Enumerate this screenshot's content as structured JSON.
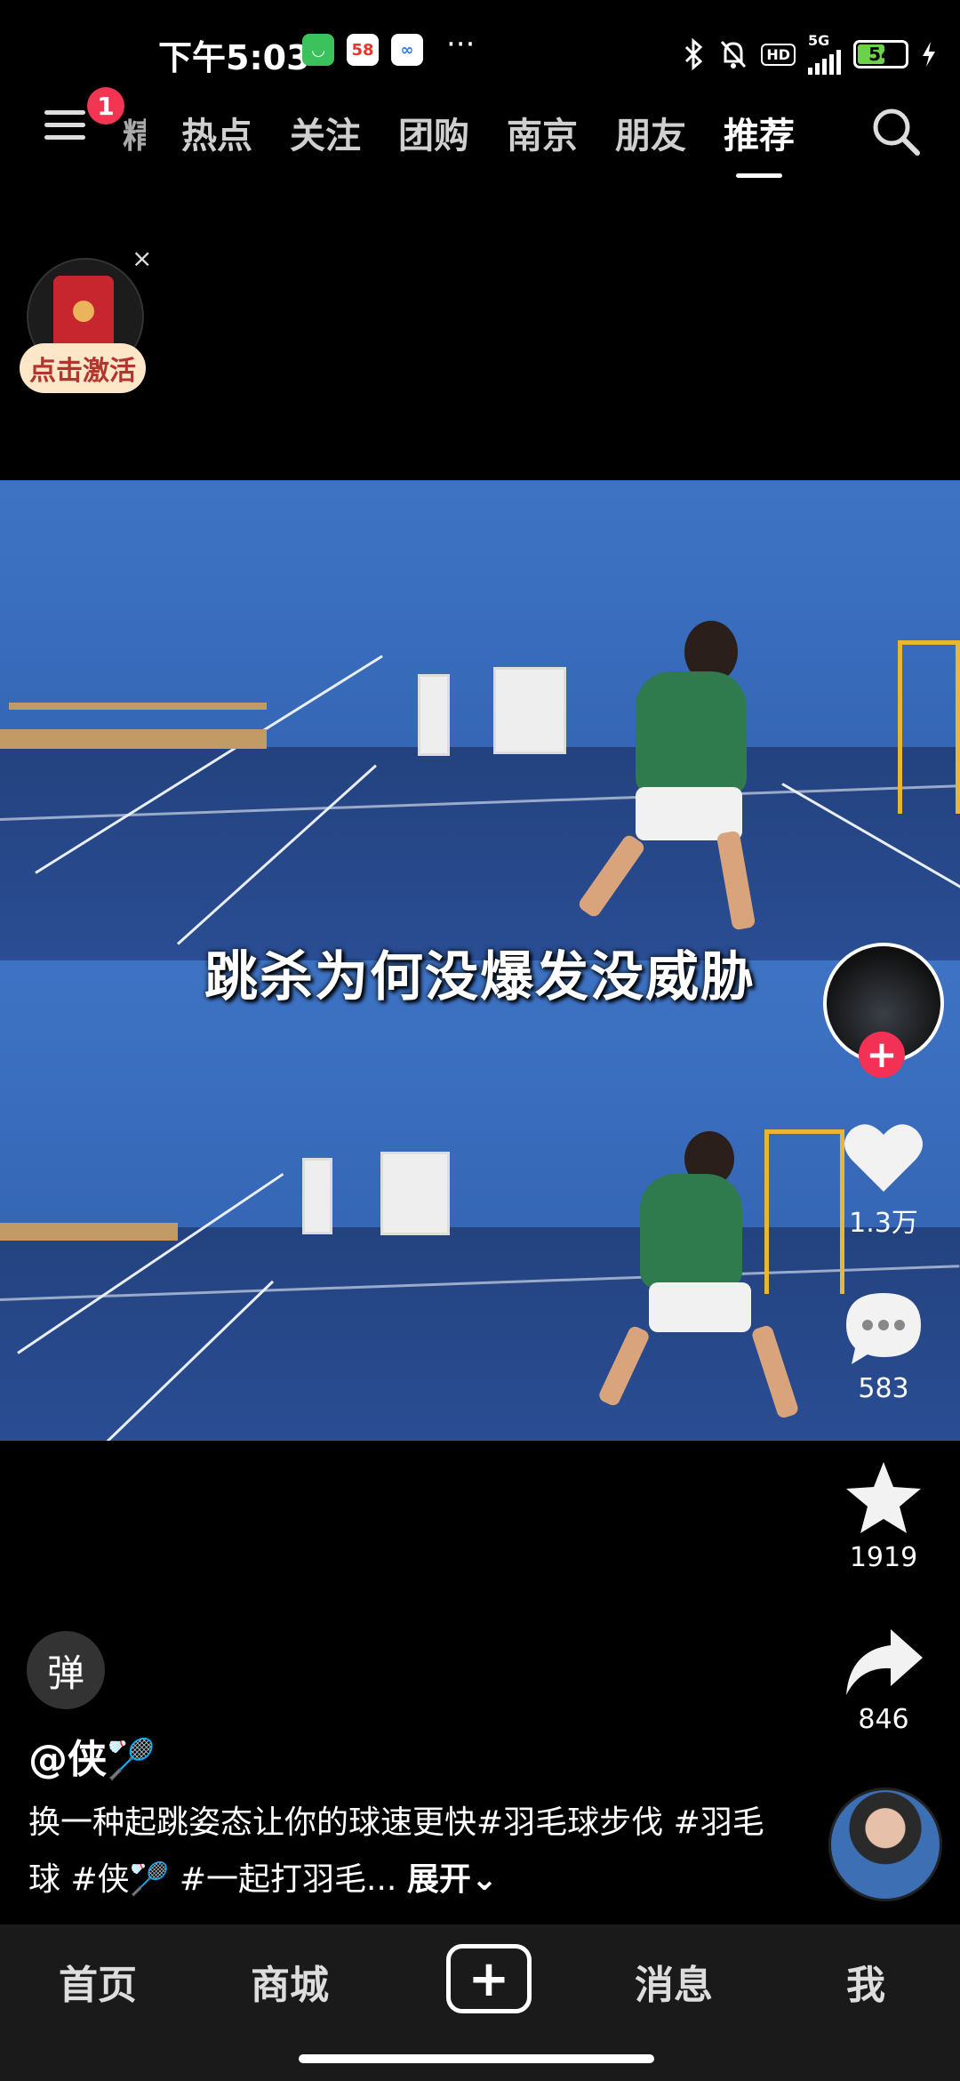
{
  "status": {
    "time": "下午5:03",
    "app_icons": [
      "wechat-app-icon",
      "58-app-icon",
      "community-app-icon"
    ],
    "more": "···",
    "network": "5G",
    "hd": "HD",
    "battery": "54",
    "battery_level": 0.54,
    "icons": [
      "bluetooth-icon",
      "mute-icon",
      "hd-icon",
      "signal-icon",
      "battery-icon",
      "charging-icon"
    ]
  },
  "nav": {
    "badge": "1",
    "partial_tab": "精选",
    "tabs": [
      "热点",
      "关注",
      "团购",
      "南京",
      "朋友",
      "推荐"
    ],
    "active_tab": "推荐"
  },
  "promo": {
    "button": "点击激活",
    "close": "×"
  },
  "video": {
    "caption": "跳杀为何没爆发没威胁"
  },
  "actions": {
    "likes": "1.3万",
    "comments": "583",
    "favorites": "1919",
    "shares": "846",
    "follow": "+"
  },
  "post": {
    "danmaku": "弹",
    "author": "@侠🏸",
    "description": "换一种起跳姿态让你的球速更快#羽毛球步伐 #羽毛球 #侠🏸 #一起打羽毛...",
    "expand": "展开"
  },
  "bottom_nav": {
    "home": "首页",
    "mall": "商城",
    "create": "+",
    "messages": "消息",
    "me": "我"
  },
  "colors": {
    "accent_red": "#f23552",
    "court_blue": "#2e62b7",
    "tab_bar": "#1a1a1a"
  }
}
